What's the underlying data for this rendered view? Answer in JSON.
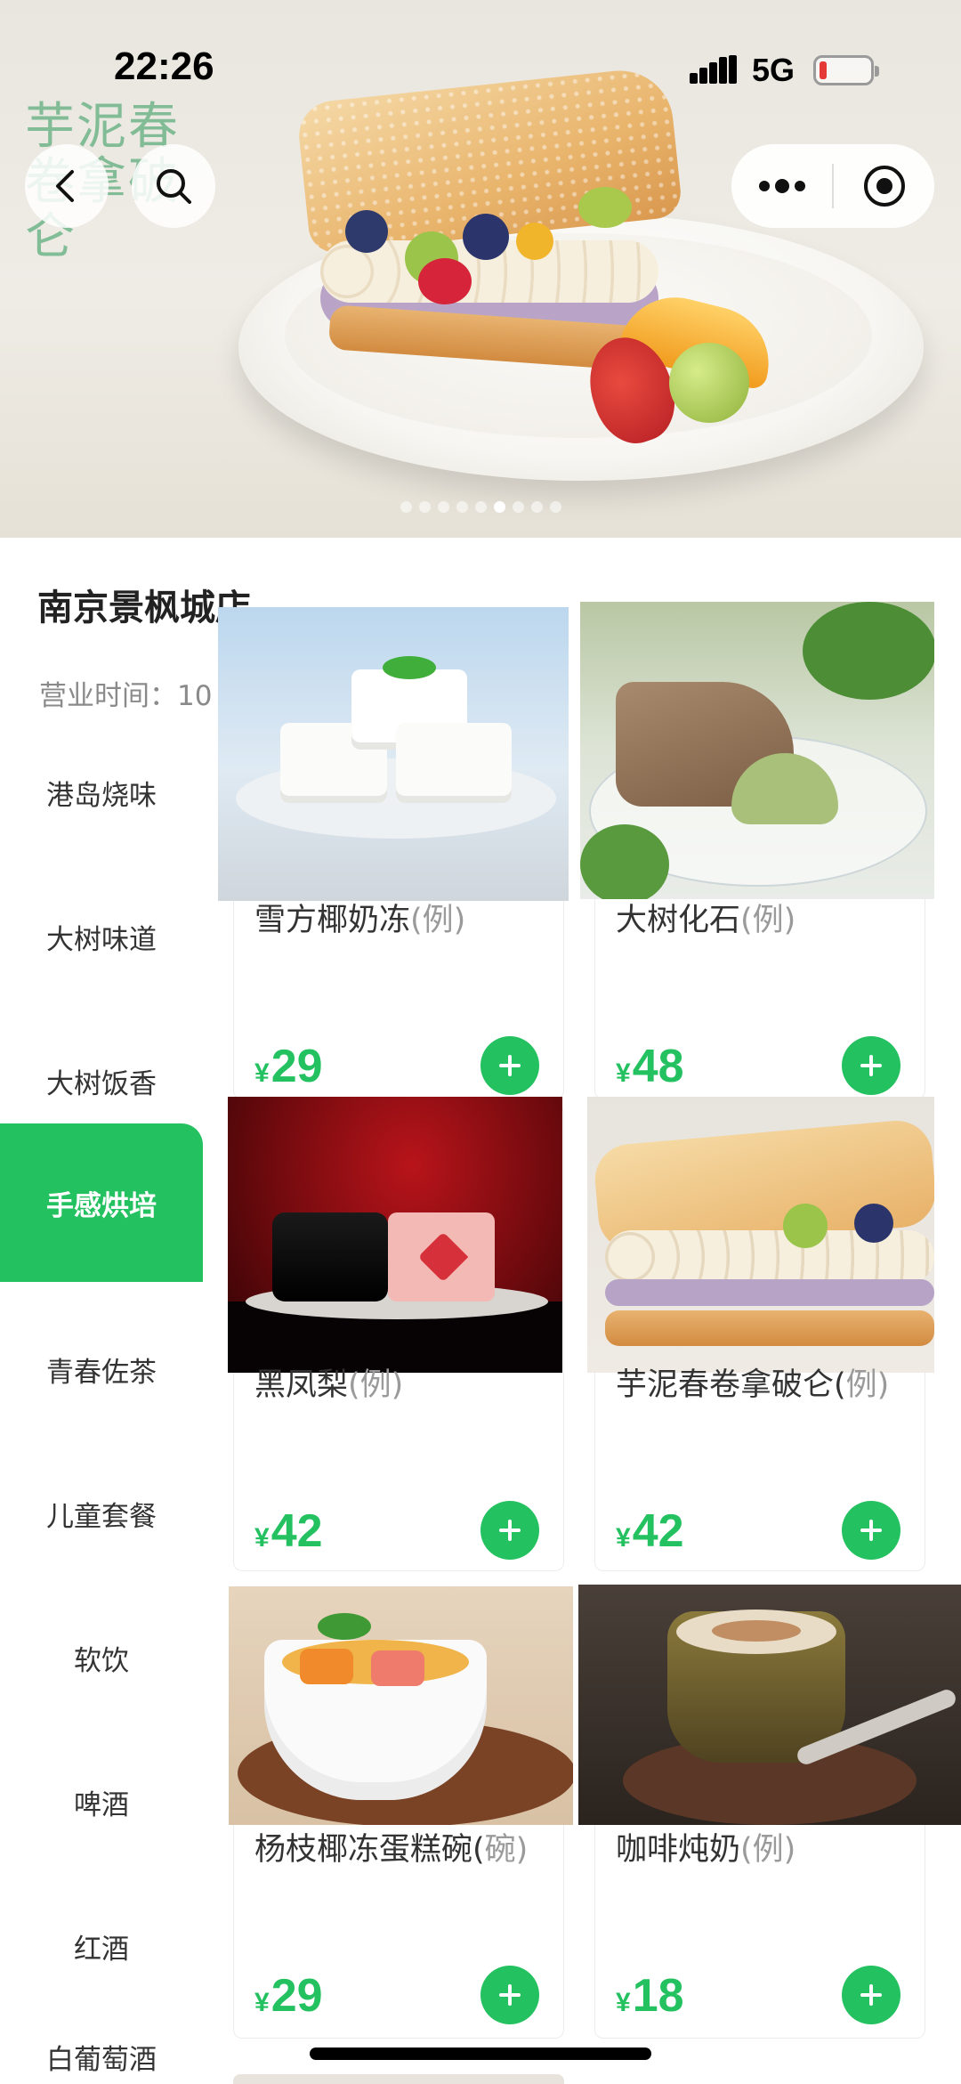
{
  "status_bar": {
    "time": "22:26",
    "network": "5G"
  },
  "banner": {
    "promo_title": "芋泥春卷拿破仑",
    "slide_count": 9,
    "active_slide": 5
  },
  "store": {
    "name": "南京景枫城店",
    "hours_label": "营业时间：10"
  },
  "sidebar": {
    "active_index": 3,
    "items": [
      {
        "label": "港岛烧味"
      },
      {
        "label": "大树味道"
      },
      {
        "label": "大树饭香"
      },
      {
        "label": "手感烘培"
      },
      {
        "label": "青春佐茶"
      },
      {
        "label": "儿童套餐"
      },
      {
        "label": "软饮"
      },
      {
        "label": "啤酒"
      },
      {
        "label": "红酒"
      },
      {
        "label": "白葡萄酒"
      }
    ]
  },
  "products": [
    {
      "name": "雪方椰奶冻",
      "unit": "(例)",
      "currency": "¥",
      "price": "29"
    },
    {
      "name": "大树化石",
      "unit": "(例)",
      "currency": "¥",
      "price": "48"
    },
    {
      "name": "黑凤梨",
      "unit": "(例)",
      "currency": "¥",
      "price": "42"
    },
    {
      "name": "芋泥春卷拿破仑(",
      "unit": "例)",
      "currency": "¥",
      "price": "42"
    },
    {
      "name": "杨枝椰冻蛋糕碗(",
      "unit": "碗)",
      "currency": "¥",
      "price": "29"
    },
    {
      "name": "咖啡炖奶",
      "unit": "(例)",
      "currency": "¥",
      "price": "18"
    }
  ],
  "icons": {
    "back": "back-arrow-icon",
    "search": "search-icon",
    "more": "more-dots-icon",
    "close": "close-miniprogram-icon",
    "add": "plus-icon"
  },
  "colors": {
    "accent": "#23c160",
    "price": "#23c160",
    "battery_low": "#e53935"
  }
}
